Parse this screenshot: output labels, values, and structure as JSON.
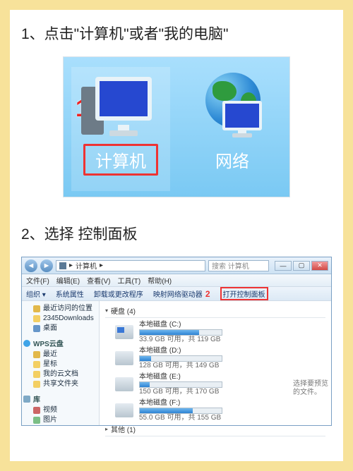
{
  "step1": {
    "title": "1、点击\"计算机\"或者\"我的电脑\"",
    "callout": "1",
    "computer_label": "计算机",
    "network_label": "网络"
  },
  "step2": {
    "title": "2、选择 控制面板",
    "callout": "2",
    "address_label": "计算机",
    "search_placeholder": "搜索 计算机",
    "menubar": [
      "文件(F)",
      "编辑(E)",
      "查看(V)",
      "工具(T)",
      "帮助(H)"
    ],
    "toolbar": {
      "organize": "组织 ▾",
      "sys_props": "系统属性",
      "uninstall": "卸载或更改程序",
      "map_drive": "映射网络驱动器",
      "open_cp": "打开控制面板"
    },
    "sidebar": {
      "recent": "最近访问的位置",
      "downloads": "2345Downloads",
      "desktop": "桌面",
      "wps_head": "WPS云盘",
      "wps_recent": "最近",
      "wps_star": "星标",
      "wps_mydoc": "我的云文档",
      "wps_share": "共享文件夹",
      "lib_head": "库",
      "lib_video": "视频",
      "lib_pic": "图片"
    },
    "content": {
      "disks_header": "硬盘 (4)",
      "other_header": "其他 (1)",
      "drives": [
        {
          "name": "本地磁盘 (C:)",
          "detail": "33.9 GB 可用，共 119 GB",
          "fill": 72
        },
        {
          "name": "本地磁盘 (D:)",
          "detail": "128 GB 可用，共 149 GB",
          "fill": 14
        },
        {
          "name": "本地磁盘 (E:)",
          "detail": "150 GB 可用，共 170 GB",
          "fill": 12
        },
        {
          "name": "本地磁盘 (F:)",
          "detail": "55.0 GB 可用，共 155 GB",
          "fill": 65
        }
      ],
      "right_note_l1": "选择要预览",
      "right_note_l2": "的文件。"
    }
  }
}
